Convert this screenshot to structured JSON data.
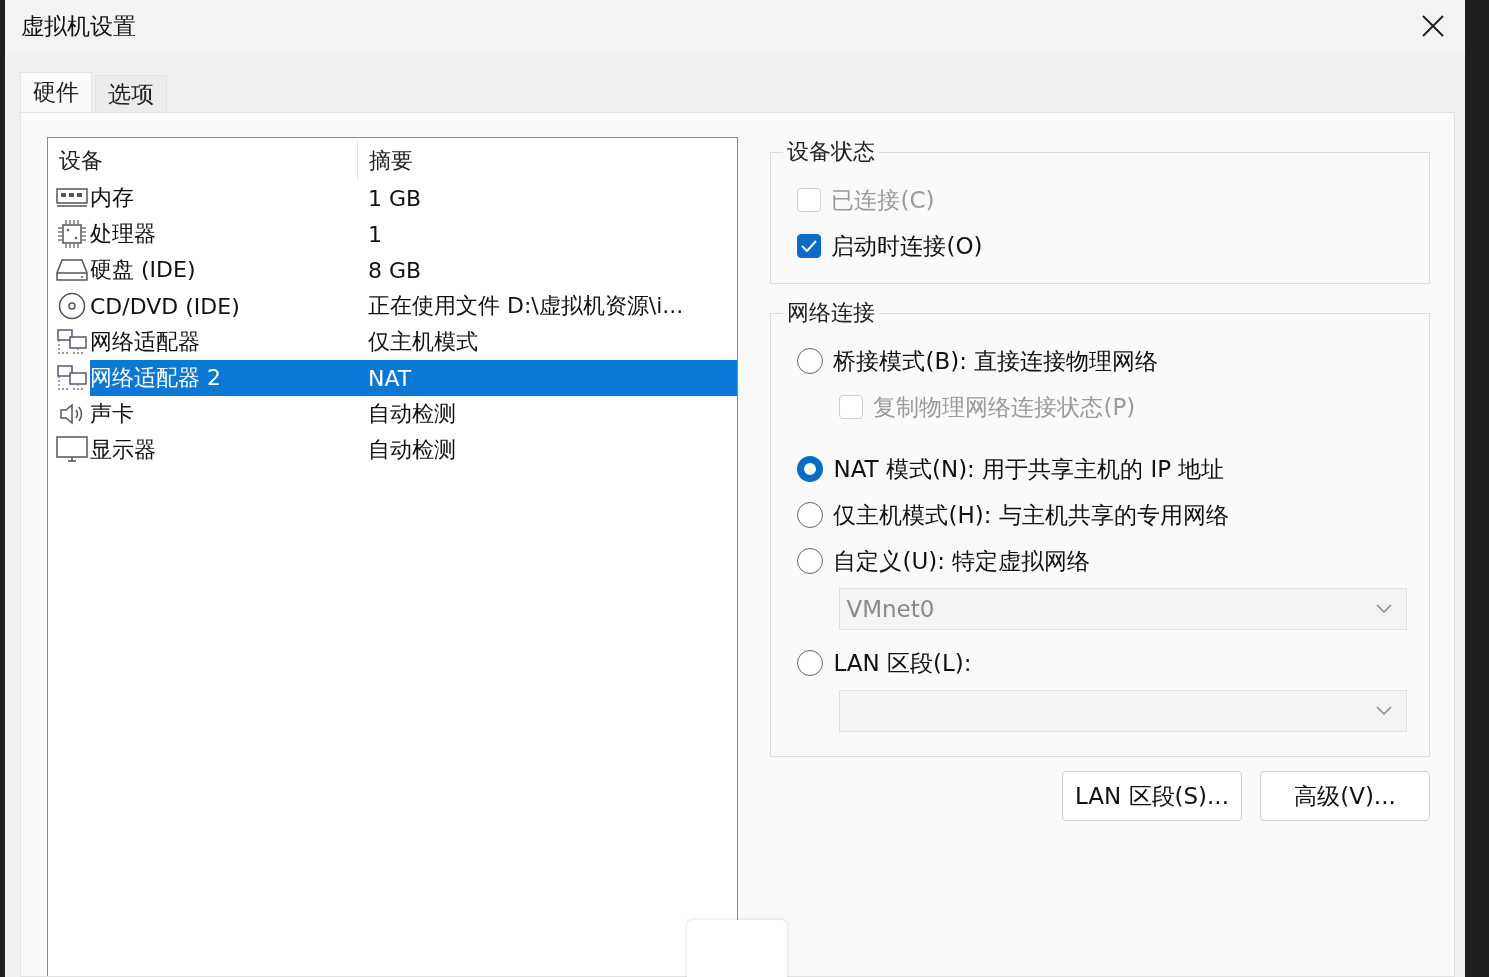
{
  "window": {
    "title": "虚拟机设置"
  },
  "tabs": [
    {
      "label": "硬件",
      "selected": true
    },
    {
      "label": "选项",
      "selected": false
    }
  ],
  "devices": {
    "columns": [
      "设备",
      "摘要"
    ],
    "rows": [
      {
        "kind": "memory",
        "name": "内存",
        "summary": "1 GB",
        "selected": false
      },
      {
        "kind": "cpu",
        "name": "处理器",
        "summary": "1",
        "selected": false
      },
      {
        "kind": "disk",
        "name": "硬盘 (IDE)",
        "summary": "8 GB",
        "selected": false
      },
      {
        "kind": "cd",
        "name": "CD/DVD (IDE)",
        "summary": "正在使用文件 D:\\虚拟机资源\\i...",
        "selected": false
      },
      {
        "kind": "network",
        "name": "网络适配器",
        "summary": "仅主机模式",
        "selected": false
      },
      {
        "kind": "network",
        "name": "网络适配器 2",
        "summary": "NAT",
        "selected": true
      },
      {
        "kind": "sound",
        "name": "声卡",
        "summary": "自动检测",
        "selected": false
      },
      {
        "kind": "display",
        "name": "显示器",
        "summary": "自动检测",
        "selected": false
      }
    ]
  },
  "device_status": {
    "title": "设备状态",
    "items": [
      {
        "label": "已连接(C)",
        "checked": false,
        "disabled": true
      },
      {
        "label": "启动时连接(O)",
        "checked": true,
        "disabled": false
      }
    ]
  },
  "network": {
    "title": "网络连接",
    "items": [
      {
        "kind": "radio",
        "label": "桥接模式(B): 直接连接物理网络",
        "selected": false
      },
      {
        "kind": "checkbox",
        "label": "复制物理网络连接状态(P)",
        "checked": false,
        "disabled": true
      },
      {
        "kind": "radio",
        "label": "NAT 模式(N): 用于共享主机的 IP 地址",
        "selected": true
      },
      {
        "kind": "radio",
        "label": "仅主机模式(H): 与主机共享的专用网络",
        "selected": false
      },
      {
        "kind": "radio",
        "label": "自定义(U): 特定虚拟网络",
        "selected": false
      },
      {
        "kind": "select",
        "value": "VMnet0",
        "disabled": true
      },
      {
        "kind": "radio",
        "label": "LAN 区段(L):",
        "selected": false
      },
      {
        "kind": "select",
        "disabled": true
      }
    ]
  },
  "buttons": [
    "LAN 区段(S)...",
    "高级(V)..."
  ]
}
